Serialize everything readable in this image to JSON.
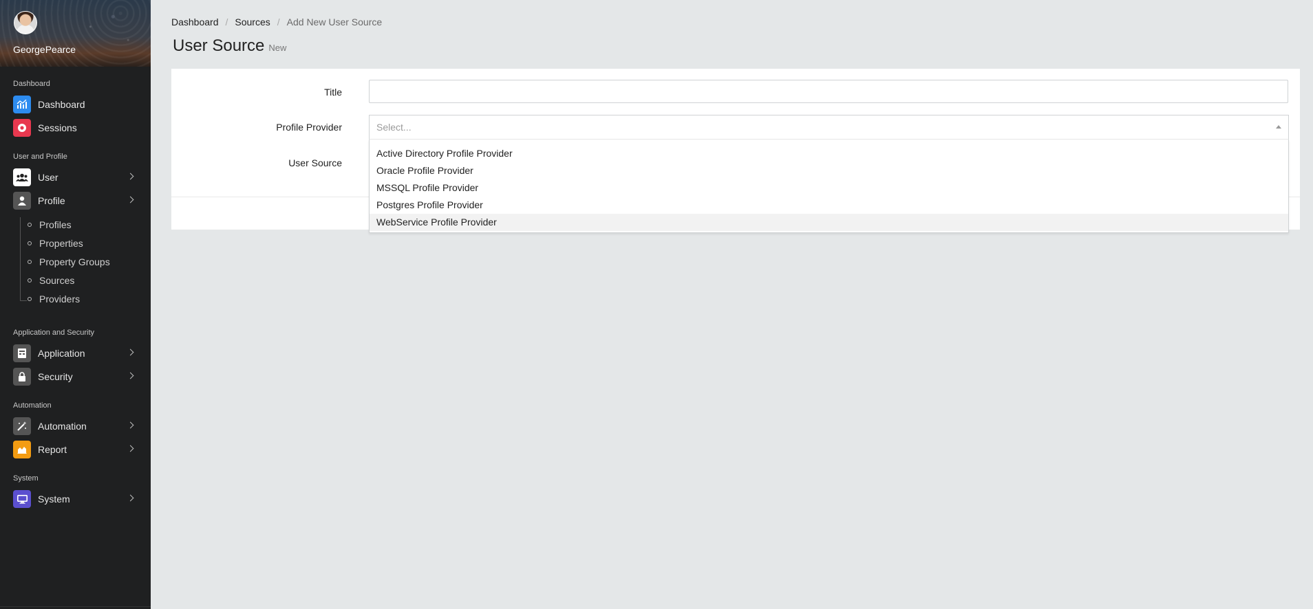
{
  "user": {
    "name": "GeorgePearce"
  },
  "sidebar": {
    "sections": [
      {
        "title": "Dashboard"
      },
      {
        "title": "User and Profile"
      },
      {
        "title": "Application and Security"
      },
      {
        "title": "Automation"
      },
      {
        "title": "System"
      }
    ],
    "items": [
      {
        "label": "Dashboard",
        "icon": "chart-icon",
        "color": "#2d8cf0"
      },
      {
        "label": "Sessions",
        "icon": "record-icon",
        "color": "#e8384f"
      },
      {
        "label": "User",
        "icon": "users-icon",
        "color": "#ffffff"
      },
      {
        "label": "Profile",
        "icon": "person-icon",
        "color": "#555555"
      },
      {
        "label": "Application",
        "icon": "app-icon",
        "color": "#555555"
      },
      {
        "label": "Security",
        "icon": "lock-icon",
        "color": "#555555"
      },
      {
        "label": "Automation",
        "icon": "magic-wand-icon",
        "color": "#555555"
      },
      {
        "label": "Report",
        "icon": "area-chart-icon",
        "color": "#f39c12"
      },
      {
        "label": "System",
        "icon": "monitor-icon",
        "color": "#5b4fcf"
      }
    ],
    "profile_children": [
      "Profiles",
      "Properties",
      "Property Groups",
      "Sources",
      "Providers"
    ]
  },
  "breadcrumb": {
    "items": [
      "Dashboard",
      "Sources"
    ],
    "current": "Add New User Source"
  },
  "page": {
    "title": "User Source",
    "subtitle": "New"
  },
  "form": {
    "title_label": "Title",
    "title_value": "",
    "provider_label": "Profile Provider",
    "provider_placeholder": "Select...",
    "source_label": "User Source"
  },
  "dropdown": {
    "options": [
      "Active Directory Profile Provider",
      "Oracle Profile Provider",
      "MSSQL Profile Provider",
      "Postgres Profile Provider",
      "WebService Profile Provider"
    ],
    "highlighted_index": 4
  }
}
